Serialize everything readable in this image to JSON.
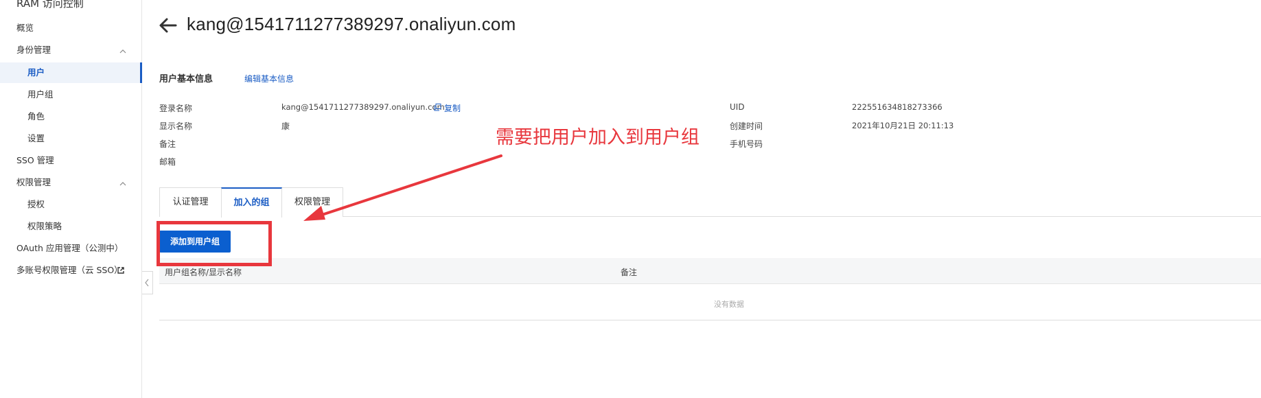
{
  "sidebar": {
    "title": "RAM 访问控制",
    "items": [
      {
        "label": "概览"
      },
      {
        "label": "身份管理"
      },
      {
        "label": "用户"
      },
      {
        "label": "用户组"
      },
      {
        "label": "角色"
      },
      {
        "label": "设置"
      },
      {
        "label": "SSO 管理"
      },
      {
        "label": "权限管理"
      },
      {
        "label": "授权"
      },
      {
        "label": "权限策略"
      },
      {
        "label": "OAuth 应用管理（公测中）"
      },
      {
        "label": "多账号权限管理（云 SSO）"
      }
    ]
  },
  "header": {
    "title": "kang@1541711277389297.onaliyun.com"
  },
  "basic_info": {
    "title": "用户基本信息",
    "edit_link": "编辑基本信息",
    "fields_left": [
      {
        "label": "登录名称",
        "value": "kang@1541711277389297.onaliyun.com"
      },
      {
        "label": "显示名称",
        "value": "康"
      },
      {
        "label": "备注",
        "value": ""
      },
      {
        "label": "邮箱",
        "value": ""
      }
    ],
    "copy_label": "复制",
    "fields_right": [
      {
        "label": "UID",
        "value": "222551634818273366"
      },
      {
        "label": "创建时间",
        "value": "2021年10月21日 20:11:13"
      },
      {
        "label": "手机号码",
        "value": ""
      }
    ]
  },
  "tabs": [
    {
      "label": "认证管理"
    },
    {
      "label": "加入的组"
    },
    {
      "label": "权限管理"
    }
  ],
  "actions": {
    "add_to_group": "添加到用户组"
  },
  "table": {
    "columns": [
      "用户组名称/显示名称",
      "备注"
    ],
    "empty_text": "没有数据"
  },
  "annotation": {
    "text": "需要把用户加入到用户组"
  },
  "colors": {
    "accent": "#1a5cc4",
    "primary_button": "#0b5fcf",
    "annotation": "#e8373d"
  }
}
